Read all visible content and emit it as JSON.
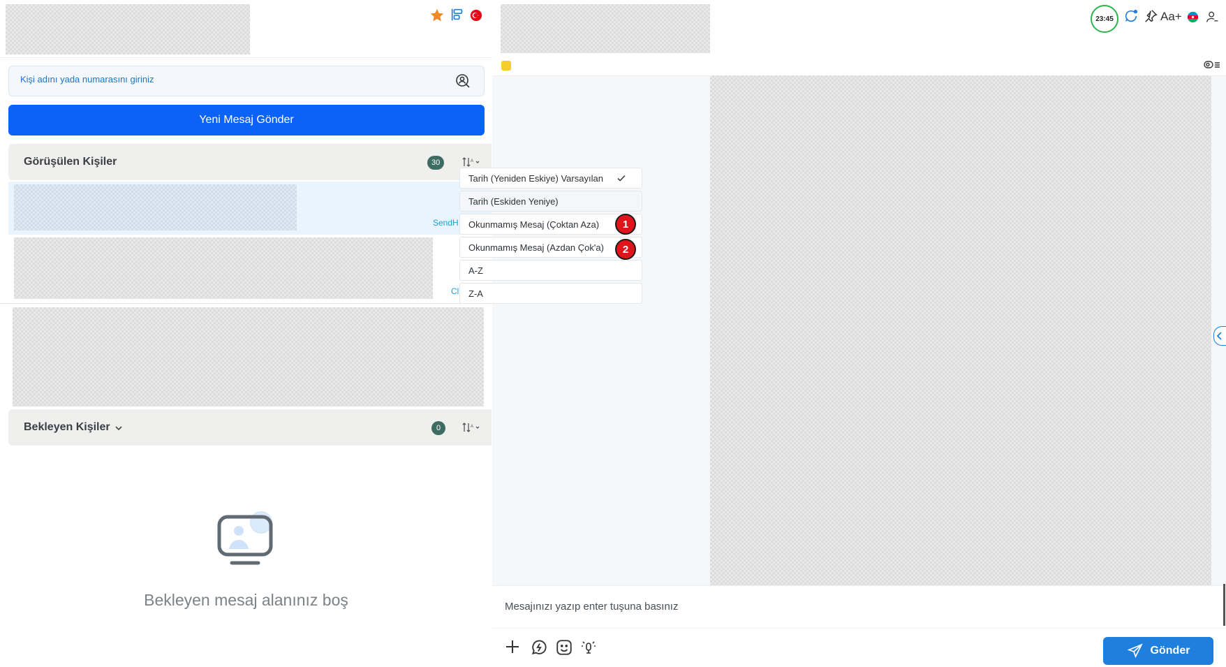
{
  "left": {
    "search": {
      "placeholder": "Kişi adını yada numarasını giriniz"
    },
    "new_message_button": "Yeni Mesaj Gönder",
    "seen_contacts": {
      "title": "Görüşülen Kişiler",
      "count": "30"
    },
    "link_fragments": [
      "SendH",
      "Cl"
    ],
    "waiting_contacts": {
      "title": "Bekleyen Kişiler",
      "count": "0"
    },
    "empty_message": "Bekleyen mesaj alanınız boş"
  },
  "sort_menu": {
    "items": [
      {
        "label": "Tarih (Yeniden Eskiye) Varsayılan",
        "selected": true
      },
      {
        "label": "Tarih (Eskiden Yeniye)",
        "selected": false
      },
      {
        "label": "Okunmamış Mesaj (Çoktan Aza)",
        "selected": false
      },
      {
        "label": "Okunmamış Mesaj (Azdan Çok'a)",
        "selected": false
      },
      {
        "label": "A-Z",
        "selected": false
      },
      {
        "label": "Z-A",
        "selected": false
      }
    ],
    "markers": [
      "1",
      "2"
    ]
  },
  "header": {
    "timer": "23:45",
    "font_size_label": "Aa+"
  },
  "composer": {
    "placeholder": "Mesajınızı yazıp enter tuşuna basınız",
    "send_label": "Gönder"
  },
  "colors": {
    "primary": "#0b62f6",
    "send": "#1f7fde",
    "badge": "#3f6c62",
    "marker": "#e0141a",
    "timer_ring": "#2fb24c"
  }
}
